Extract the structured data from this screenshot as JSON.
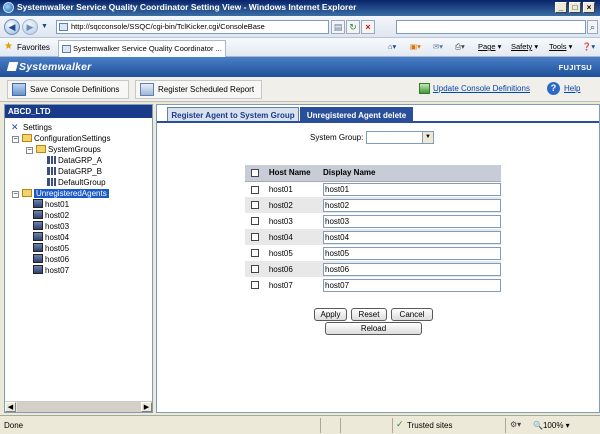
{
  "window": {
    "title": "Systemwalker Service Quality Coordinator Setting View - Windows Internet Explorer"
  },
  "browser": {
    "address": "http://sqcconsole/SSQC/cgi-bin/TclKicker.cgi/ConsoleBase",
    "favorites_label": "Favorites",
    "tab_title": "Systemwalker Service Quality Coordinator ...",
    "tools": {
      "page": "Page",
      "safety": "Safety",
      "tools": "Tools"
    }
  },
  "banner": {
    "product": "Systemwalker",
    "vendor": "FUJITSU"
  },
  "toolbar": {
    "save_label": "Save Console Definitions",
    "register_label": "Register Scheduled Report",
    "update_label": "Update Console Definitions",
    "help_label": "Help"
  },
  "tree": {
    "root": "ABCD_LTD",
    "settings": "Settings",
    "config": "ConfigurationSettings",
    "system_groups": "SystemGroups",
    "groups": [
      "DataGRP_A",
      "DataGRP_B",
      "DefaultGroup"
    ],
    "unregistered": "UnregisteredAgents",
    "hosts": [
      "host01",
      "host02",
      "host03",
      "host04",
      "host05",
      "host06",
      "host07"
    ]
  },
  "tabs": {
    "register": "Register Agent to System Group",
    "delete": "Unregistered Agent delete"
  },
  "form": {
    "system_group_label": "System Group:",
    "system_group_value": "",
    "col_host": "Host Name",
    "col_display": "Display Name",
    "rows": [
      {
        "host": "host01",
        "display": "host01"
      },
      {
        "host": "host02",
        "display": "host02"
      },
      {
        "host": "host03",
        "display": "host03"
      },
      {
        "host": "host04",
        "display": "host04"
      },
      {
        "host": "host05",
        "display": "host05"
      },
      {
        "host": "host06",
        "display": "host06"
      },
      {
        "host": "host07",
        "display": "host07"
      }
    ],
    "apply": "Apply",
    "reset": "Reset",
    "cancel": "Cancel",
    "reload": "Reload"
  },
  "status": {
    "text": "Done",
    "zone": "Trusted sites",
    "zoom": "100%"
  }
}
